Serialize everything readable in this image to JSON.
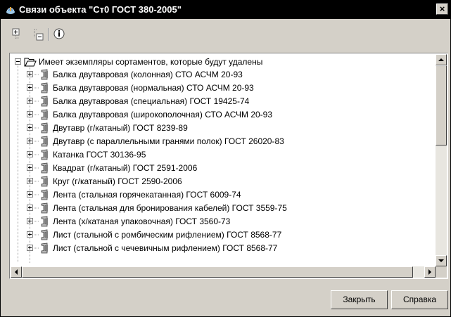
{
  "window": {
    "title": "Связи объекта \"Ст0 ГОСТ 380-2005\"",
    "close_glyph": "×"
  },
  "toolbar": {
    "buttons": [
      {
        "icon": "expand-all-icon"
      },
      {
        "icon": "collapse-all-icon"
      },
      {
        "icon": "info-icon"
      }
    ]
  },
  "tree": {
    "root": {
      "label": "Имеет экземпляры сортаментов, которые будут удалены",
      "icon": "folder-open-icon",
      "expanded": true
    },
    "children": [
      {
        "label": "Балка двутавровая (колонная) СТО АСЧМ 20-93",
        "icon": "i-beam-icon"
      },
      {
        "label": "Балка двутавровая (нормальная) СТО АСЧМ 20-93",
        "icon": "i-beam-icon"
      },
      {
        "label": "Балка двутавровая (специальная) ГОСТ 19425-74",
        "icon": "i-beam-icon"
      },
      {
        "label": "Балка двутавровая (широкополочная) СТО АСЧМ 20-93",
        "icon": "i-beam-icon"
      },
      {
        "label": "Двутавр (г/катаный) ГОСТ 8239-89",
        "icon": "i-beam-icon"
      },
      {
        "label": "Двутавр (с параллельными гранями полок) ГОСТ 26020-83",
        "icon": "i-beam-icon"
      },
      {
        "label": "Катанка ГОСТ 30136-95",
        "icon": "i-beam-icon"
      },
      {
        "label": "Квадрат (г/катаный) ГОСТ 2591-2006",
        "icon": "i-beam-icon"
      },
      {
        "label": "Круг (г/катаный) ГОСТ 2590-2006",
        "icon": "i-beam-icon"
      },
      {
        "label": "Лента (стальная горячекатанная) ГОСТ 6009-74",
        "icon": "i-beam-icon"
      },
      {
        "label": "Лента (стальная для бронирования кабелей) ГОСТ 3559-75",
        "icon": "i-beam-icon"
      },
      {
        "label": "Лента (х/катаная упаковочная) ГОСТ 3560-73",
        "icon": "i-beam-icon"
      },
      {
        "label": "Лист (стальной с ромбическим  рифлением) ГОСТ 8568-77",
        "icon": "i-beam-icon"
      },
      {
        "label": "Лист (стальной с чечевичным рифлением) ГОСТ 8568-77",
        "icon": "i-beam-icon"
      }
    ]
  },
  "scrollbars": {
    "vertical_position": 0,
    "horizontal_position": 0
  },
  "buttons": {
    "close_label": "Закрыть",
    "help_label": "Справка"
  },
  "colors": {
    "titlebar": "#000000",
    "dialog": "#d4d0c8",
    "tree_background": "#ffffff"
  }
}
